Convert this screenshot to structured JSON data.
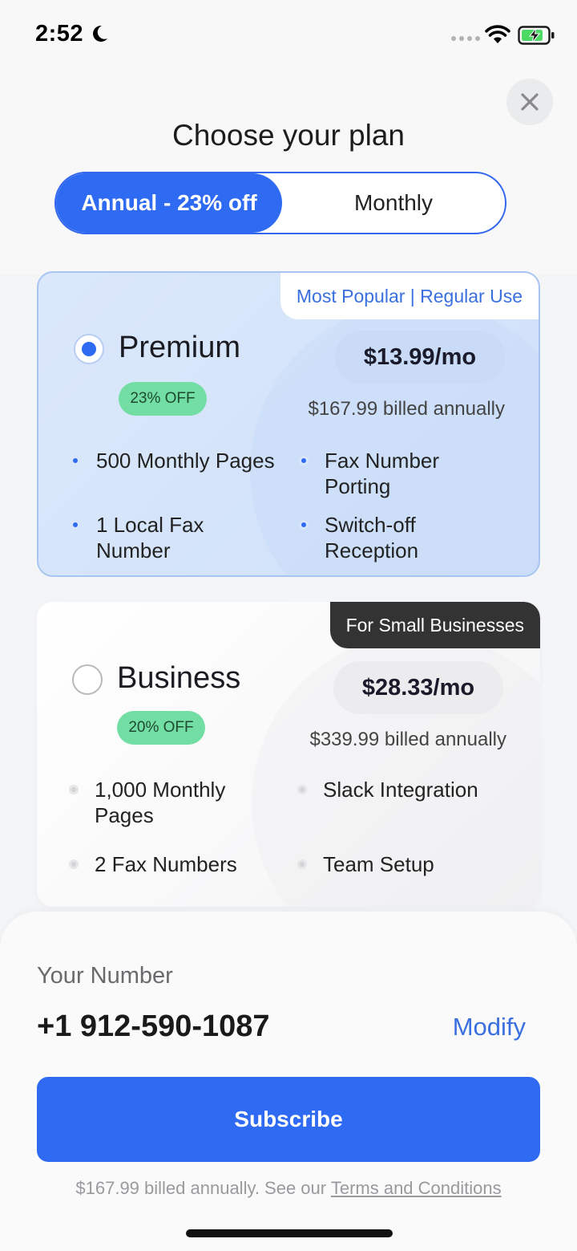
{
  "status_bar": {
    "time": "2:52",
    "icons": [
      "moon-icon",
      "cellular-dots-icon",
      "wifi-icon",
      "battery-charging-icon"
    ]
  },
  "header": {
    "title": "Choose your plan",
    "billing_toggle": {
      "annual_label": "Annual - 23% off",
      "monthly_label": "Monthly",
      "selected": "annual"
    }
  },
  "plans": [
    {
      "name": "Premium",
      "tag": "Most Popular | Regular Use",
      "discount": "23% OFF",
      "price": "$13.99/mo",
      "billed": "$167.99 billed annually",
      "selected": true,
      "features": [
        "500 Monthly Pages",
        "Fax Number Porting",
        "1 Local Fax Number",
        "Switch-off Reception"
      ]
    },
    {
      "name": "Business",
      "tag": "For Small Businesses",
      "discount": "20% OFF",
      "price": "$28.33/mo",
      "billed": "$339.99 billed annually",
      "selected": false,
      "features": [
        "1,000 Monthly Pages",
        "Slack Integration",
        "2 Fax Numbers",
        "Team Setup"
      ]
    }
  ],
  "sheet": {
    "number_label": "Your Number",
    "number_value": "+1 912-590-1087",
    "modify_label": "Modify",
    "subscribe_label": "Subscribe",
    "footnote_prefix": "$167.99 billed annually. See our ",
    "terms_label": "Terms and Conditions"
  },
  "colors": {
    "accent": "#2f6af3",
    "badge_green": "#72dea3",
    "premium_bg": "#dbe8fb",
    "dark_tag": "#333333"
  }
}
